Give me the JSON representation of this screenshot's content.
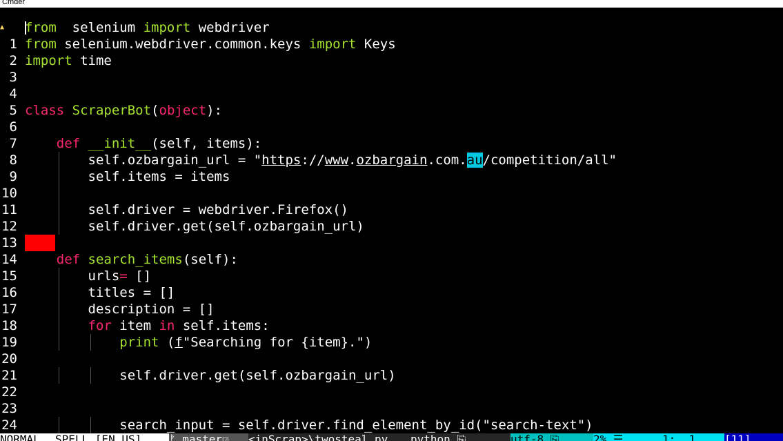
{
  "window": {
    "title": "Cmder"
  },
  "editor": {
    "cursor_line_marker": "▲",
    "lines": [
      {
        "num": "",
        "tokens": [
          [
            "kw",
            "from"
          ],
          [
            "",
            "  selenium "
          ],
          [
            "kw",
            "import"
          ],
          [
            "",
            " webdriver"
          ]
        ]
      },
      {
        "num": "1",
        "tokens": [
          [
            "kw",
            "from"
          ],
          [
            "",
            " selenium.webdriver.common.keys "
          ],
          [
            "kw",
            "import"
          ],
          [
            "",
            " Keys"
          ]
        ]
      },
      {
        "num": "2",
        "tokens": [
          [
            "kw",
            "import"
          ],
          [
            "",
            " time"
          ]
        ]
      },
      {
        "num": "3",
        "tokens": []
      },
      {
        "num": "4",
        "tokens": []
      },
      {
        "num": "5",
        "tokens": [
          [
            "kr",
            "class"
          ],
          [
            "",
            " "
          ],
          [
            "cls",
            "ScraperBot"
          ],
          [
            "",
            "("
          ],
          [
            "obj",
            "object"
          ],
          [
            "",
            "):"
          ]
        ]
      },
      {
        "num": "6",
        "tokens": []
      },
      {
        "num": "7",
        "tokens": [
          [
            "",
            "    "
          ],
          [
            "kr",
            "def"
          ],
          [
            "",
            " "
          ],
          [
            "fn",
            "__init__"
          ],
          [
            "",
            "(self, items):"
          ]
        ]
      },
      {
        "num": "8",
        "tokens": [
          [
            "",
            "        self.ozbargain_url = \""
          ],
          [
            "url",
            "https"
          ],
          [
            "",
            "://"
          ],
          [
            "url",
            "www"
          ],
          [
            "",
            "."
          ],
          [
            "url",
            "ozbargain"
          ],
          [
            "",
            ".com."
          ],
          [
            "hl",
            "au"
          ],
          [
            "",
            "/competition/all\""
          ]
        ]
      },
      {
        "num": "9",
        "tokens": [
          [
            "",
            "        self.items = items"
          ]
        ]
      },
      {
        "num": "10",
        "tokens": []
      },
      {
        "num": "11",
        "tokens": [
          [
            "",
            "        self.driver = webdriver.Firefox()"
          ]
        ]
      },
      {
        "num": "12",
        "tokens": [
          [
            "",
            "        self.driver.get(self.ozbargain_url)"
          ]
        ]
      },
      {
        "num": "13",
        "tokens": []
      },
      {
        "num": "14",
        "tokens": [
          [
            "",
            "    "
          ],
          [
            "kr",
            "def"
          ],
          [
            "",
            " "
          ],
          [
            "fn",
            "search_items"
          ],
          [
            "",
            "(self):"
          ]
        ]
      },
      {
        "num": "15",
        "tokens": [
          [
            "",
            "        urls"
          ],
          [
            "kr",
            "="
          ],
          [
            "",
            " []"
          ]
        ]
      },
      {
        "num": "16",
        "tokens": [
          [
            "",
            "        titles = []"
          ]
        ]
      },
      {
        "num": "17",
        "tokens": [
          [
            "",
            "        description = []"
          ]
        ]
      },
      {
        "num": "18",
        "tokens": [
          [
            "",
            "        "
          ],
          [
            "kr",
            "for"
          ],
          [
            "",
            " item "
          ],
          [
            "kr",
            "in"
          ],
          [
            "",
            " self.items:"
          ]
        ]
      },
      {
        "num": "19",
        "tokens": [
          [
            "",
            "            "
          ],
          [
            "kw",
            "print"
          ],
          [
            "",
            " ("
          ],
          [
            "url",
            "f"
          ],
          [
            "",
            "\"Searching for {item}.\")"
          ]
        ]
      },
      {
        "num": "20",
        "tokens": []
      },
      {
        "num": "21",
        "tokens": [
          [
            "",
            "            self.driver.get(self.ozbargain_url)"
          ]
        ]
      },
      {
        "num": "22",
        "tokens": []
      },
      {
        "num": "23",
        "tokens": []
      },
      {
        "num": "24",
        "tokens": [
          [
            "",
            "            search_input = self.driver.find_element_by_id(\"search-text\")"
          ]
        ]
      }
    ]
  },
  "statusbar": {
    "mode": "NORMAL",
    "spell": "SPELL [EN_US]",
    "branch": "ᚠ master☑",
    "file": "<inScrap>\\twosteal.py",
    "filetype": "python ⎘",
    "encoding": "utf-8 ⎘",
    "percent": "2% ☰",
    "position": "1:  1",
    "extra": "[11]"
  },
  "colors": {
    "background": "#000000",
    "keyword": "#a6e22e",
    "reserved": "#f92672",
    "highlight": "#00c8e0",
    "marker": "#ff0000"
  }
}
